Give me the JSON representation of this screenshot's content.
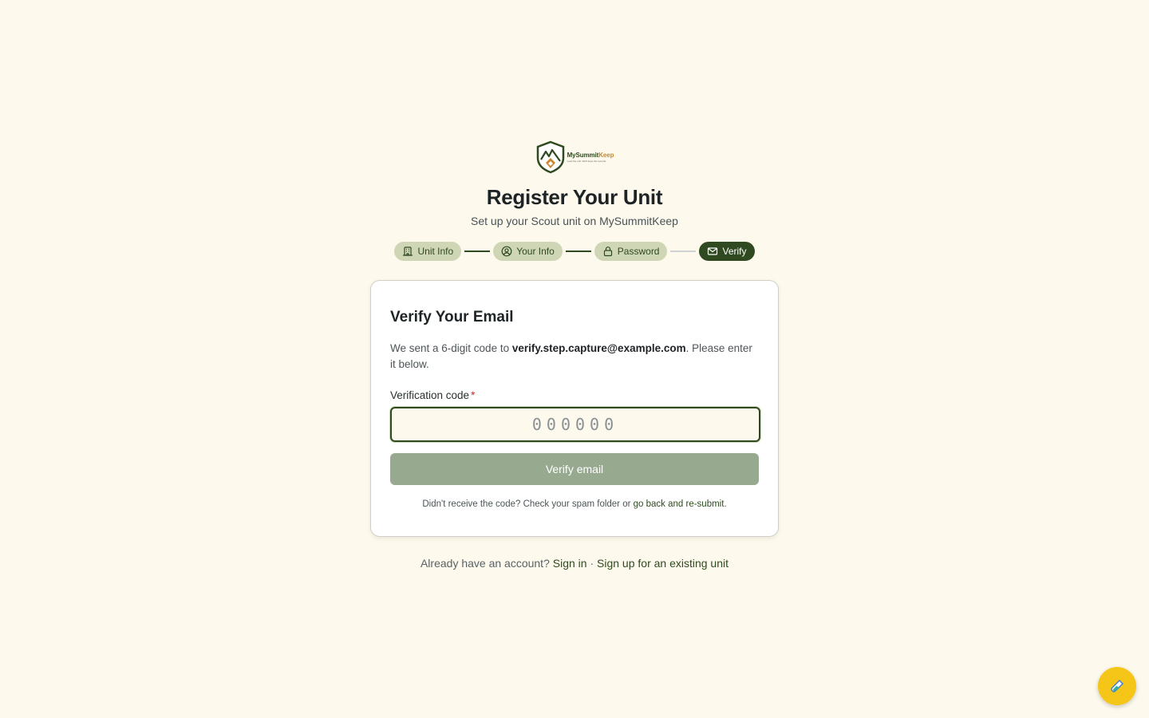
{
  "logo": {
    "name_part1": "MySummit",
    "name_part2": "Keep",
    "tagline": "Lead the unit. We'll keep the records."
  },
  "header": {
    "title": "Register Your Unit",
    "subtitle": "Set up your Scout unit on MySummitKeep"
  },
  "steps": [
    {
      "label": "Unit Info",
      "icon": "building-icon",
      "status": "complete"
    },
    {
      "label": "Your Info",
      "icon": "user-circle-icon",
      "status": "complete"
    },
    {
      "label": "Password",
      "icon": "lock-icon",
      "status": "complete"
    },
    {
      "label": "Verify",
      "icon": "mail-icon",
      "status": "active"
    }
  ],
  "card": {
    "title": "Verify Your Email",
    "desc_prefix": "We sent a 6-digit code to ",
    "email": "verify.step.capture@example.com",
    "desc_suffix": ". Please enter it below.",
    "field_label": "Verification code",
    "required_mark": "*",
    "code_value": "",
    "code_placeholder": "000000",
    "button_label": "Verify email",
    "help_prefix": "Didn't receive the code? Check your spam folder or ",
    "help_link": "go back and re-submit",
    "help_suffix": "."
  },
  "footer": {
    "prefix": "Already have an account? ",
    "signin_link": "Sign in",
    "separator": " · ",
    "existing_link": "Sign up for an existing unit"
  },
  "fab": {
    "icon": "test-tube-icon"
  },
  "colors": {
    "background": "#fdf9ec",
    "brand_green": "#2f4a20",
    "step_pill": "#cfd6b6",
    "button_disabled": "#97a98f",
    "fab_yellow": "#f5c518"
  }
}
